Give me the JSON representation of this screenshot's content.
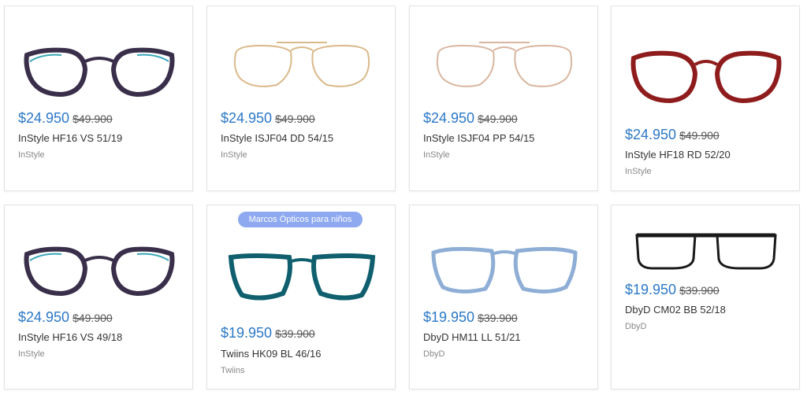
{
  "badge": {
    "label": "Marcos Ópticos para niños"
  },
  "products": [
    {
      "price": "$24.950",
      "old_price": "$49.900",
      "model": "InStyle HF16 VS 51/19",
      "brand": "InStyle",
      "frame_color": "#3a2f4a",
      "accent": "#3aa6b8"
    },
    {
      "price": "$24.950",
      "old_price": "$49.900",
      "model": "InStyle ISJF04 DD 54/15",
      "brand": "InStyle",
      "frame_color": "#d9b98a"
    },
    {
      "price": "$24.950",
      "old_price": "$49.900",
      "model": "InStyle ISJF04 PP 54/15",
      "brand": "InStyle",
      "frame_color": "#d8b6a0"
    },
    {
      "price": "$24.950",
      "old_price": "$49.900",
      "model": "InStyle HF18 RD 52/20",
      "brand": "InStyle",
      "frame_color": "#8e1c1c"
    },
    {
      "price": "$24.950",
      "old_price": "$49.900",
      "model": "InStyle HF16 VS 49/18",
      "brand": "InStyle",
      "frame_color": "#3a2f4a",
      "accent": "#3aa6b8"
    },
    {
      "price": "$19.950",
      "old_price": "$39.900",
      "model": "Twiins HK09 BL 46/16",
      "brand": "Twiins",
      "frame_color": "#0f5f6e"
    },
    {
      "price": "$19.950",
      "old_price": "$39.900",
      "model": "DbyD HM11 LL 51/21",
      "brand": "DbyD",
      "frame_color": "#8eaed6"
    },
    {
      "price": "$19.950",
      "old_price": "$39.900",
      "model": "DbyD CM02 BB 52/18",
      "brand": "DbyD",
      "frame_color": "#1a1a1a"
    }
  ]
}
